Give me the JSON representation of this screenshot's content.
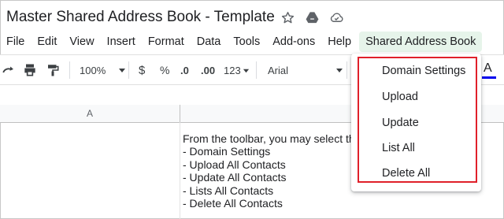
{
  "document": {
    "title": "Master Shared Address Book - Template"
  },
  "menu": {
    "items": [
      "File",
      "Edit",
      "View",
      "Insert",
      "Format",
      "Data",
      "Tools",
      "Add-ons",
      "Help"
    ],
    "active": "Shared Address Book"
  },
  "toolbar": {
    "zoom": "100%",
    "currency": "$",
    "percent": "%",
    "decrease_decimal": ".0",
    "increase_decimal": ".00",
    "more_formats": "123",
    "font": "Arial",
    "text_color_label": "A"
  },
  "grid": {
    "column_a": "A",
    "cell_lines": [
      "From the toolbar, you may select th",
      "- Domain Settings",
      "- Upload All Contacts",
      "- Update All Contacts",
      "- Lists All Contacts",
      "- Delete All Contacts"
    ]
  },
  "dropdown": {
    "items": [
      "Domain Settings",
      "Upload",
      "Update",
      "List All",
      "Delete All"
    ],
    "highlight_color": "#e0202a"
  },
  "icons": [
    "star-icon",
    "drive-icon",
    "cloud-done-icon",
    "redo-icon",
    "print-icon",
    "paint-format-icon",
    "chevron-down-icon"
  ]
}
